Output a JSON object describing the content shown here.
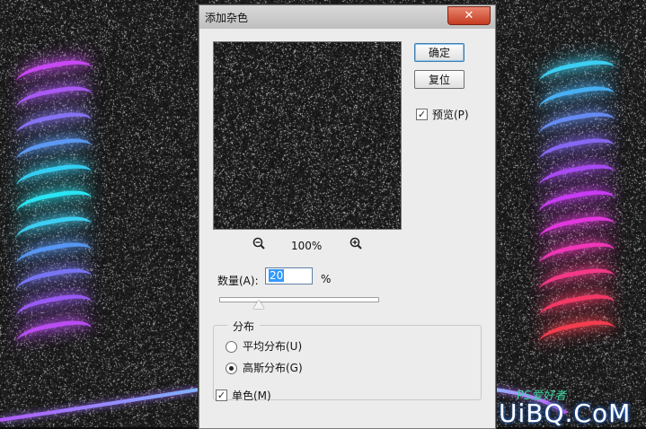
{
  "dialog": {
    "title": "添加杂色",
    "close_glyph": "✕",
    "ok_label": "确定",
    "reset_label": "复位",
    "preview_label": "预览(P)",
    "preview_checked": true,
    "zoom_out_icon": "zoom-out-icon",
    "zoom_in_icon": "zoom-in-icon",
    "zoom_level": "100%",
    "amount_label": "数量(A):",
    "amount_value": "20",
    "amount_unit": "%",
    "slider_fraction": 0.25,
    "distribution": {
      "title": "分布",
      "uniform_label": "平均分布(U)",
      "gaussian_label": "高斯分布(G)",
      "selected": "gaussian"
    },
    "mono_label": "单色(M)",
    "mono_checked": true
  },
  "watermark": {
    "logo": "UiBQ.CoM",
    "sub": "PS爱好者"
  },
  "colors": {
    "left_coil": [
      "#d24bff",
      "#b05dff",
      "#8c78ff",
      "#5fa0ff",
      "#36d9ff",
      "#2bf0ff",
      "#40d8ff",
      "#5a9dff",
      "#7d7bff",
      "#9f5dff",
      "#c350ff"
    ],
    "right_coil": [
      "#3fd9ff",
      "#4ab8ff",
      "#6a92ff",
      "#8c6cff",
      "#b04dff",
      "#d23eff",
      "#ec39e7",
      "#fb38c0",
      "#ff3a8e",
      "#ff3a6a",
      "#ff3f52"
    ]
  }
}
